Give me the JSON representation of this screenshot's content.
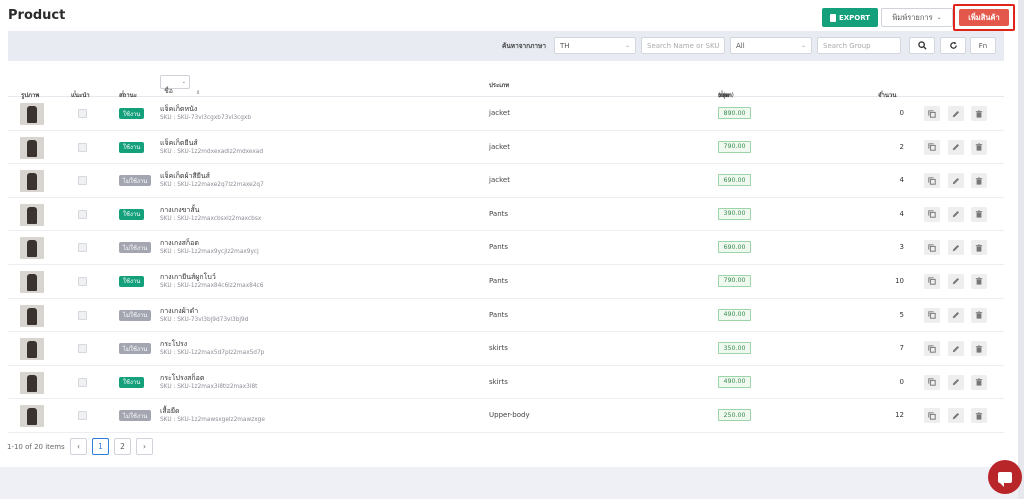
{
  "header": {
    "title": "Product",
    "export_label": "EXPORT",
    "print_label": "พิมพ์รายการ",
    "add_label": "เพิ่มสินค้า"
  },
  "filters": {
    "language_label": "ค้นหาจากภาษา",
    "language_value": "TH",
    "search_name_placeholder": "Search Name or SKU",
    "group_value": "All",
    "search_group_placeholder": "Search Group",
    "fn_label": "Fn"
  },
  "table": {
    "headers": {
      "image": "รูปภาพ",
      "recommend": "แนะนำ",
      "status": "สถานะ",
      "name_select": "ชื่อ",
      "category": "ประเภท",
      "price": "ราคา",
      "price_unit": "(บาท)",
      "group": "กลุ่ม",
      "quantity": "จำนวน"
    },
    "rows": [
      {
        "name": "แจ็คเก็ตหนัง",
        "sku": "SKU : SKU-73vl3cgxb73vl3cgxb",
        "status": "ใช้งาน",
        "active": true,
        "category": "jacket",
        "price": "890.00",
        "qty": "0"
      },
      {
        "name": "แจ็คเก็ตยีนส์",
        "sku": "SKU : SKU-1z2mdxexadlz2mdxexad",
        "status": "ใช้งาน",
        "active": true,
        "category": "jacket",
        "price": "790.00",
        "qty": "2"
      },
      {
        "name": "แจ็คเก็ตผ้าสียีนส์",
        "sku": "SKU : SKU-1z2maxe2q7lz2maxe2q7",
        "status": "ไม่ใช้งาน",
        "active": false,
        "category": "jacket",
        "price": "690.00",
        "qty": "4"
      },
      {
        "name": "กางเกงขาสั้น",
        "sku": "SKU : SKU-1z2maxcbsxlz2maxcbsx",
        "status": "ใช้งาน",
        "active": true,
        "category": "Pants",
        "price": "390.00",
        "qty": "4"
      },
      {
        "name": "กางเกงสก็อต",
        "sku": "SKU : SKU-1z2max9ycjlz2max9ycj",
        "status": "ไม่ใช้งาน",
        "active": false,
        "category": "Pants",
        "price": "690.00",
        "qty": "3"
      },
      {
        "name": "กางเกายีนส์ผูกโบว์",
        "sku": "SKU : SKU-1z2max84c6lz2max84c6",
        "status": "ใช้งาน",
        "active": true,
        "category": "Pants",
        "price": "790.00",
        "qty": "10"
      },
      {
        "name": "กางเกงผ้าดำ",
        "sku": "SKU : SKU-73vl3bj9d73vl3bj9d",
        "status": "ไม่ใช้งาน",
        "active": false,
        "category": "Pants",
        "price": "490.00",
        "qty": "5"
      },
      {
        "name": "กระโปรง",
        "sku": "SKU : SKU-1z2max5d7plz2max5d7p",
        "status": "ไม่ใช้งาน",
        "active": false,
        "category": "skirts",
        "price": "350.00",
        "qty": "7"
      },
      {
        "name": "กระโปรงสก็อต",
        "sku": "SKU : SKU-1z2max3i8tlz2max3i8t",
        "status": "ใช้งาน",
        "active": true,
        "category": "skirts",
        "price": "490.00",
        "qty": "0"
      },
      {
        "name": "เสื้อยืด",
        "sku": "SKU : SKU-1z2mawsxgelz2mawzxge",
        "status": "ไม่ใช้งาน",
        "active": false,
        "category": "Upper-body",
        "price": "250.00",
        "qty": "12"
      }
    ]
  },
  "pagination": {
    "summary": "1-10 of 20 items",
    "prev": "‹",
    "pages": [
      "1",
      "2"
    ],
    "next": "›",
    "current": "1"
  },
  "icons": {
    "copy": "copy-icon",
    "edit": "pencil-icon",
    "delete": "trash-icon",
    "search": "search-icon",
    "refresh": "refresh-icon",
    "chat": "chat-icon"
  },
  "colors": {
    "active_status": "#13a07a",
    "inactive_status": "#a3a5b0",
    "add_button": "#e4574b",
    "highlight_border": "#e0241c",
    "export_button": "#13a07a",
    "chat_bubble": "#b8262a"
  }
}
